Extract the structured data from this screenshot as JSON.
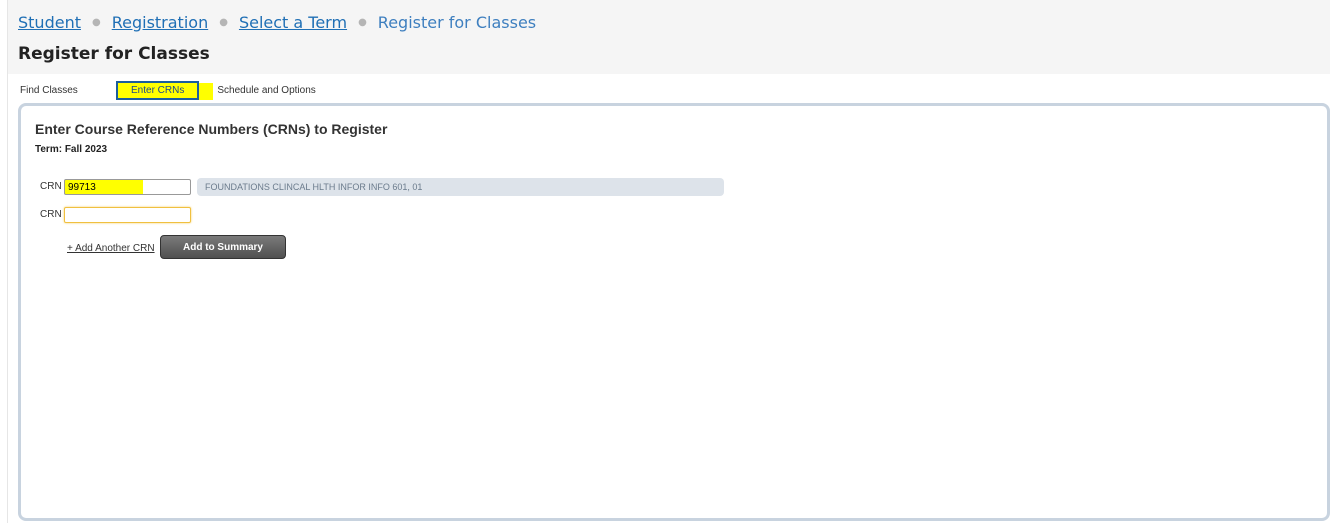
{
  "breadcrumb": {
    "items": [
      "Student",
      "Registration",
      "Select a Term"
    ],
    "current": "Register for Classes"
  },
  "page_title": "Register for Classes",
  "tabs": [
    {
      "label": "Find Classes",
      "active": false
    },
    {
      "label": "Enter CRNs",
      "active": true
    },
    {
      "label": "Schedule and Options",
      "active": false
    }
  ],
  "panel": {
    "heading": "Enter Course Reference Numbers (CRNs) to Register",
    "term": "Term: Fall 2023",
    "crn_label": "CRN",
    "rows": [
      {
        "value": "99713",
        "course": "FOUNDATIONS CLINCAL HLTH INFOR INFO 601, 01"
      },
      {
        "value": "",
        "course": ""
      }
    ],
    "add_link": "+ Add Another CRN",
    "add_button": "Add to Summary"
  },
  "colors": {
    "link": "#1f6fb5",
    "highlight": "#ffff00",
    "panel_border": "#c8d3df",
    "button": "#505050"
  }
}
